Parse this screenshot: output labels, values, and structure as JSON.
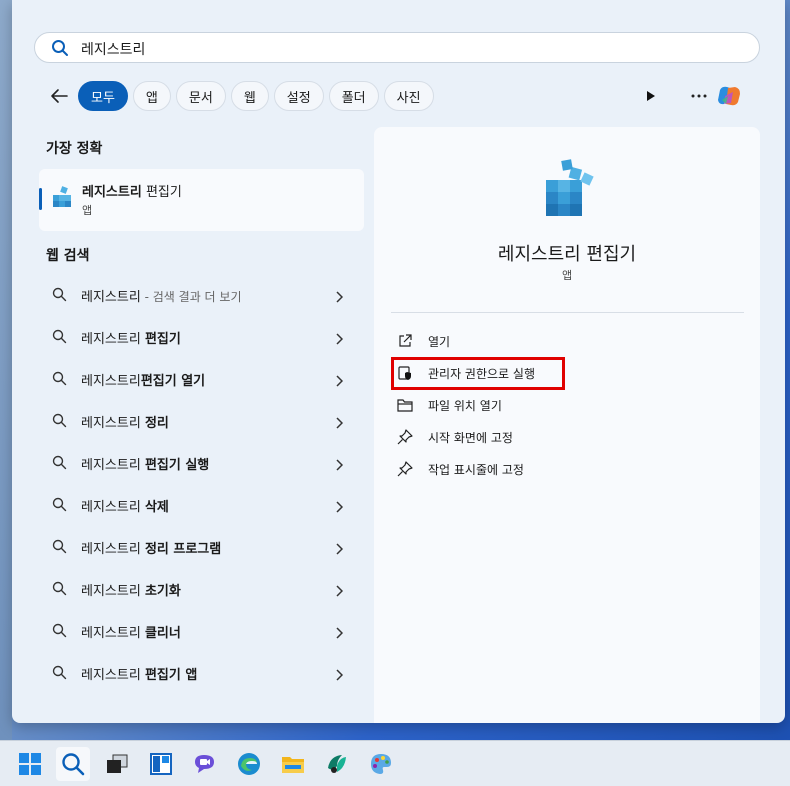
{
  "search": {
    "value": "레지스트리"
  },
  "filters": {
    "chips": [
      "모두",
      "앱",
      "문서",
      "웹",
      "설정",
      "폴더",
      "사진"
    ]
  },
  "best_match": {
    "heading": "가장 정확",
    "name_bold": "레지스트리",
    "name_rest": " 편집기",
    "kind": "앱"
  },
  "web_search": {
    "heading": "웹 검색",
    "items": [
      {
        "base": "레지스트리",
        "bold": "",
        "sub": " - 검색 결과 더 보기"
      },
      {
        "base": "레지스트리 ",
        "bold": "편집기",
        "sub": ""
      },
      {
        "base": "레지스트리",
        "bold": "편집기 열기",
        "sub": ""
      },
      {
        "base": "레지스트리 ",
        "bold": "정리",
        "sub": ""
      },
      {
        "base": "레지스트리 ",
        "bold": "편집기 실행",
        "sub": ""
      },
      {
        "base": "레지스트리 ",
        "bold": "삭제",
        "sub": ""
      },
      {
        "base": "레지스트리 ",
        "bold": "정리 프로그램",
        "sub": ""
      },
      {
        "base": "레지스트리 ",
        "bold": "초기화",
        "sub": ""
      },
      {
        "base": "레지스트리 ",
        "bold": "클리너",
        "sub": ""
      },
      {
        "base": "레지스트리 ",
        "bold": "편집기 앱",
        "sub": ""
      }
    ]
  },
  "detail": {
    "title": "레지스트리 편집기",
    "subtitle": "앱",
    "actions": [
      {
        "label": "열기",
        "icon": "open-external-icon"
      },
      {
        "label": "관리자 권한으로 실행",
        "icon": "run-as-admin-icon"
      },
      {
        "label": "파일 위치 열기",
        "icon": "folder-icon"
      },
      {
        "label": "시작 화면에 고정",
        "icon": "pin-icon"
      },
      {
        "label": "작업 표시줄에 고정",
        "icon": "pin-icon"
      }
    ]
  },
  "colors": {
    "accent": "#0a5fb8",
    "highlight": "#e00000"
  },
  "taskbar": {
    "icons": [
      "windows-start-icon",
      "search-icon",
      "task-view-icon",
      "widgets-icon",
      "chat-icon",
      "edge-browser-icon",
      "file-explorer-icon",
      "copilot-app-icon",
      "paint-icon"
    ]
  }
}
